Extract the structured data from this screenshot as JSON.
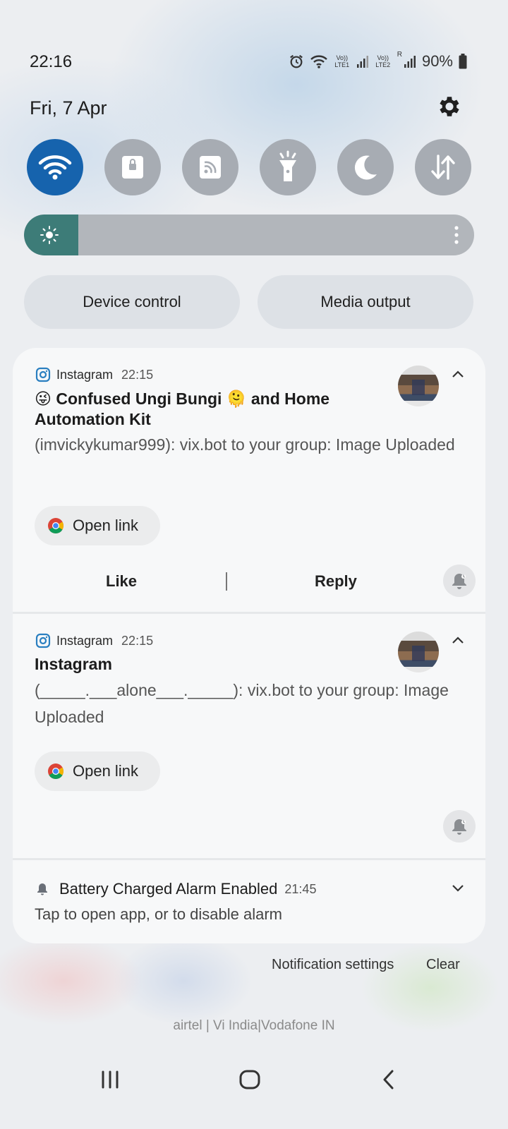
{
  "status_bar": {
    "time": "22:16",
    "battery_percent": "90%",
    "lte1_label": "Vo)) LTE1",
    "lte2_label": "Vo)) LTE2",
    "roaming": "R"
  },
  "header": {
    "date": "Fri, 7 Apr"
  },
  "quick_tiles": [
    {
      "icon": "wifi-icon",
      "active": true
    },
    {
      "icon": "lock-icon",
      "active": false
    },
    {
      "icon": "cast-icon",
      "active": false
    },
    {
      "icon": "flashlight-icon",
      "active": false
    },
    {
      "icon": "moon-icon",
      "active": false
    },
    {
      "icon": "data-transfer-icon",
      "active": false
    }
  ],
  "brightness": {
    "level": 0.12
  },
  "buttons": {
    "device_control": "Device control",
    "media_output": "Media output"
  },
  "notifications": [
    {
      "app": "Instagram",
      "time": "22:15",
      "title_emoji_1": "😜",
      "title_part_1": "Confused Ungi Bungi",
      "title_emoji_2": "🫠",
      "title_part_2": "and Home Automation Kit",
      "body": "(imvickykumar999): vix.bot to your group: Image Uploaded",
      "open_link": "Open link",
      "action_like": "Like",
      "action_reply": "Reply"
    },
    {
      "app": "Instagram",
      "time": "22:15",
      "title": "Instagram",
      "body": "(_____.___alone___._____): vix.bot to your group: Image Uploaded",
      "open_link": "Open link"
    },
    {
      "title": "Battery Charged Alarm Enabled",
      "time": "21:45",
      "body": "Tap to open app, or to disable alarm"
    }
  ],
  "footer": {
    "notification_settings": "Notification settings",
    "clear": "Clear",
    "carrier": "airtel | Vi India|Vodafone IN"
  },
  "colors": {
    "accent": "#1663ad",
    "tile_inactive": "#a7acb3",
    "brightness_fill": "#3d7c78"
  }
}
